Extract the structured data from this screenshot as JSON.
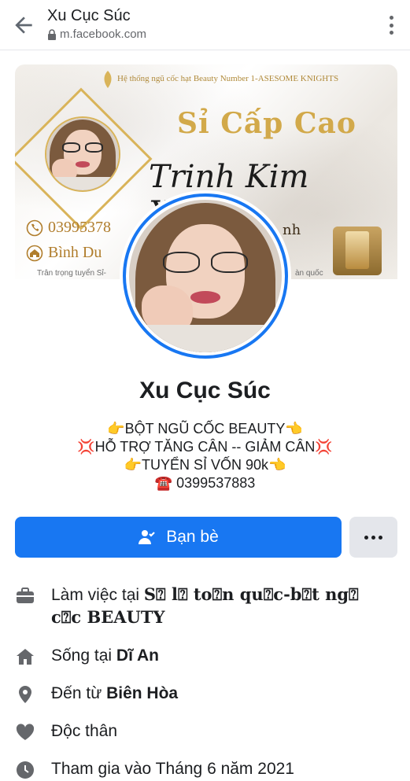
{
  "topbar": {
    "page_title": "Xu Cục Súc",
    "url": "m.facebook.com"
  },
  "cover": {
    "header_line": "Hệ thống ngũ cốc hạt Beauty Number 1-ASESOME KNIGHTS",
    "headline": "Sỉ Cấp Cao",
    "name_script": "Trinh Kim Xuân",
    "name_tail": "nh",
    "phone": "03995378",
    "address": "Bình Du",
    "footer_left": "Trân trọng tuyển Sỉ-",
    "footer_right": "àn quốc"
  },
  "profile": {
    "name": "Xu Cục Súc",
    "bio": [
      "👉BỘT NGŨ CỐC BEAUTY👈",
      "💢HỖ TRỢ TĂNG CÂN -- GIẢM CÂN💢",
      "👉TUYỂN SỈ VỐN 90k👈",
      "☎️ 0399537883"
    ]
  },
  "actions": {
    "friend_label": "Bạn bè",
    "more_label": "More options"
  },
  "info": {
    "work_prefix": "Làm việc tại ",
    "work_place": "S⍰ l⍰ to⍰n qu⍰c-b⍰t ng⍰ c⍰c BEAUTY",
    "lives_prefix": "Sống tại ",
    "lives_place": "Dĩ An",
    "from_prefix": "Đến từ ",
    "from_place": "Biên Hòa",
    "relationship": "Độc thân",
    "joined": "Tham gia vào Tháng 6 năm 2021"
  },
  "colors": {
    "brand": "#1877f2",
    "secondary_button": "#e4e6eb",
    "icon": "#65676b",
    "cover_gold": "#d2a94a"
  },
  "icons": {
    "back": "arrow-left-icon",
    "lock": "lock-icon",
    "kebab": "more-vertical-icon",
    "friend": "person-check-icon",
    "more": "more-horizontal-icon",
    "work": "briefcase-icon",
    "home": "home-icon",
    "location": "location-pin-icon",
    "relationship": "heart-icon",
    "joined": "clock-icon"
  }
}
